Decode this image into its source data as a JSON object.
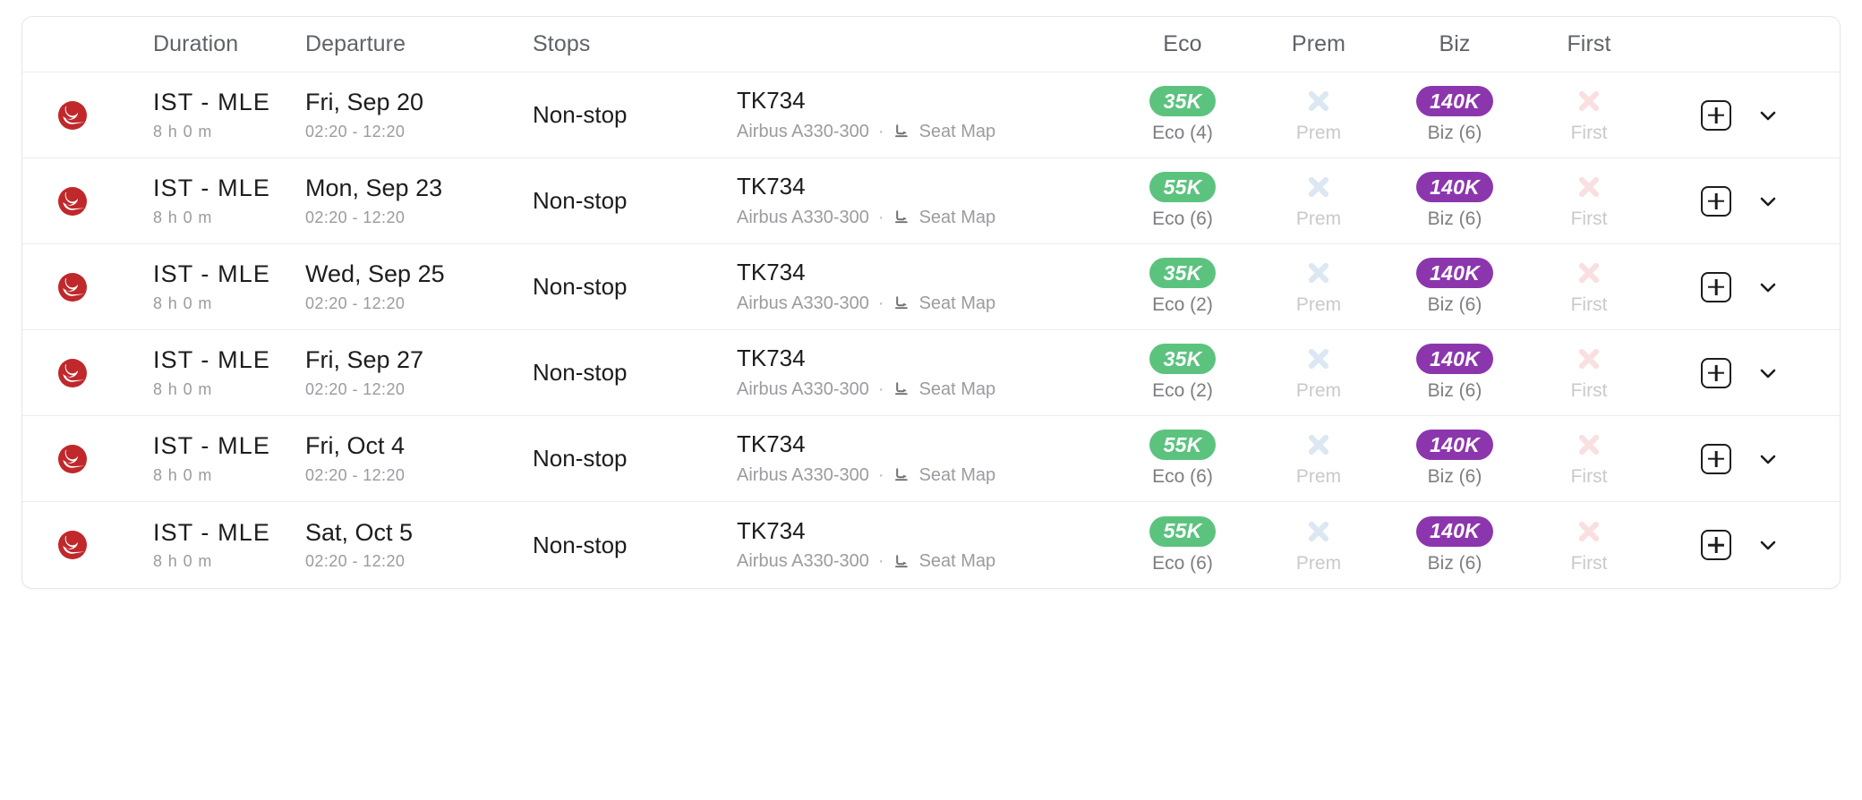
{
  "table": {
    "columns": {
      "airline": "",
      "duration": "Duration",
      "departure": "Departure",
      "stops": "Stops",
      "flight": "",
      "eco": "Eco",
      "prem": "Prem",
      "biz": "Biz",
      "first": "First"
    },
    "colors": {
      "eco_pill": "#5cc37f",
      "biz_pill": "#8c36ae",
      "prem_unavailable_x": "#dbe7f2",
      "first_unavailable_x": "#fadfe0",
      "airline_logo_red": "#c0282b",
      "row_border": "#ececee",
      "header_text": "#5f6368",
      "muted_text": "#9b9ba0"
    },
    "icons": {
      "seat_map": "seat-icon",
      "add": "plus-icon",
      "expand": "chevron-down-icon"
    },
    "links": {
      "seat_map": "Seat Map"
    },
    "separator": "·",
    "rows": [
      {
        "airline_logo": "turkish-airlines-logo",
        "route": "IST - MLE",
        "duration": "8 h 0 m",
        "departure_date": "Fri, Sep 20",
        "departure_times": "02:20 - 12:20",
        "stops": "Non-stop",
        "flight_number": "TK734",
        "aircraft": "Airbus A330-300",
        "eco": {
          "available": true,
          "price": "35K",
          "label": "Eco (4)"
        },
        "prem": {
          "available": false,
          "price": "",
          "label": "Prem"
        },
        "biz": {
          "available": true,
          "price": "140K",
          "label": "Biz (6)"
        },
        "first": {
          "available": false,
          "price": "",
          "label": "First"
        }
      },
      {
        "airline_logo": "turkish-airlines-logo",
        "route": "IST - MLE",
        "duration": "8 h 0 m",
        "departure_date": "Mon, Sep 23",
        "departure_times": "02:20 - 12:20",
        "stops": "Non-stop",
        "flight_number": "TK734",
        "aircraft": "Airbus A330-300",
        "eco": {
          "available": true,
          "price": "55K",
          "label": "Eco (6)"
        },
        "prem": {
          "available": false,
          "price": "",
          "label": "Prem"
        },
        "biz": {
          "available": true,
          "price": "140K",
          "label": "Biz (6)"
        },
        "first": {
          "available": false,
          "price": "",
          "label": "First"
        }
      },
      {
        "airline_logo": "turkish-airlines-logo",
        "route": "IST - MLE",
        "duration": "8 h 0 m",
        "departure_date": "Wed, Sep 25",
        "departure_times": "02:20 - 12:20",
        "stops": "Non-stop",
        "flight_number": "TK734",
        "aircraft": "Airbus A330-300",
        "eco": {
          "available": true,
          "price": "35K",
          "label": "Eco (2)"
        },
        "prem": {
          "available": false,
          "price": "",
          "label": "Prem"
        },
        "biz": {
          "available": true,
          "price": "140K",
          "label": "Biz (6)"
        },
        "first": {
          "available": false,
          "price": "",
          "label": "First"
        }
      },
      {
        "airline_logo": "turkish-airlines-logo",
        "route": "IST - MLE",
        "duration": "8 h 0 m",
        "departure_date": "Fri, Sep 27",
        "departure_times": "02:20 - 12:20",
        "stops": "Non-stop",
        "flight_number": "TK734",
        "aircraft": "Airbus A330-300",
        "eco": {
          "available": true,
          "price": "35K",
          "label": "Eco (2)"
        },
        "prem": {
          "available": false,
          "price": "",
          "label": "Prem"
        },
        "biz": {
          "available": true,
          "price": "140K",
          "label": "Biz (6)"
        },
        "first": {
          "available": false,
          "price": "",
          "label": "First"
        }
      },
      {
        "airline_logo": "turkish-airlines-logo",
        "route": "IST - MLE",
        "duration": "8 h 0 m",
        "departure_date": "Fri, Oct 4",
        "departure_times": "02:20 - 12:20",
        "stops": "Non-stop",
        "flight_number": "TK734",
        "aircraft": "Airbus A330-300",
        "eco": {
          "available": true,
          "price": "55K",
          "label": "Eco (6)"
        },
        "prem": {
          "available": false,
          "price": "",
          "label": "Prem"
        },
        "biz": {
          "available": true,
          "price": "140K",
          "label": "Biz (6)"
        },
        "first": {
          "available": false,
          "price": "",
          "label": "First"
        }
      },
      {
        "airline_logo": "turkish-airlines-logo",
        "route": "IST - MLE",
        "duration": "8 h 0 m",
        "departure_date": "Sat, Oct 5",
        "departure_times": "02:20 - 12:20",
        "stops": "Non-stop",
        "flight_number": "TK734",
        "aircraft": "Airbus A330-300",
        "eco": {
          "available": true,
          "price": "55K",
          "label": "Eco (6)"
        },
        "prem": {
          "available": false,
          "price": "",
          "label": "Prem"
        },
        "biz": {
          "available": true,
          "price": "140K",
          "label": "Biz (6)"
        },
        "first": {
          "available": false,
          "price": "",
          "label": "First"
        }
      }
    ]
  }
}
